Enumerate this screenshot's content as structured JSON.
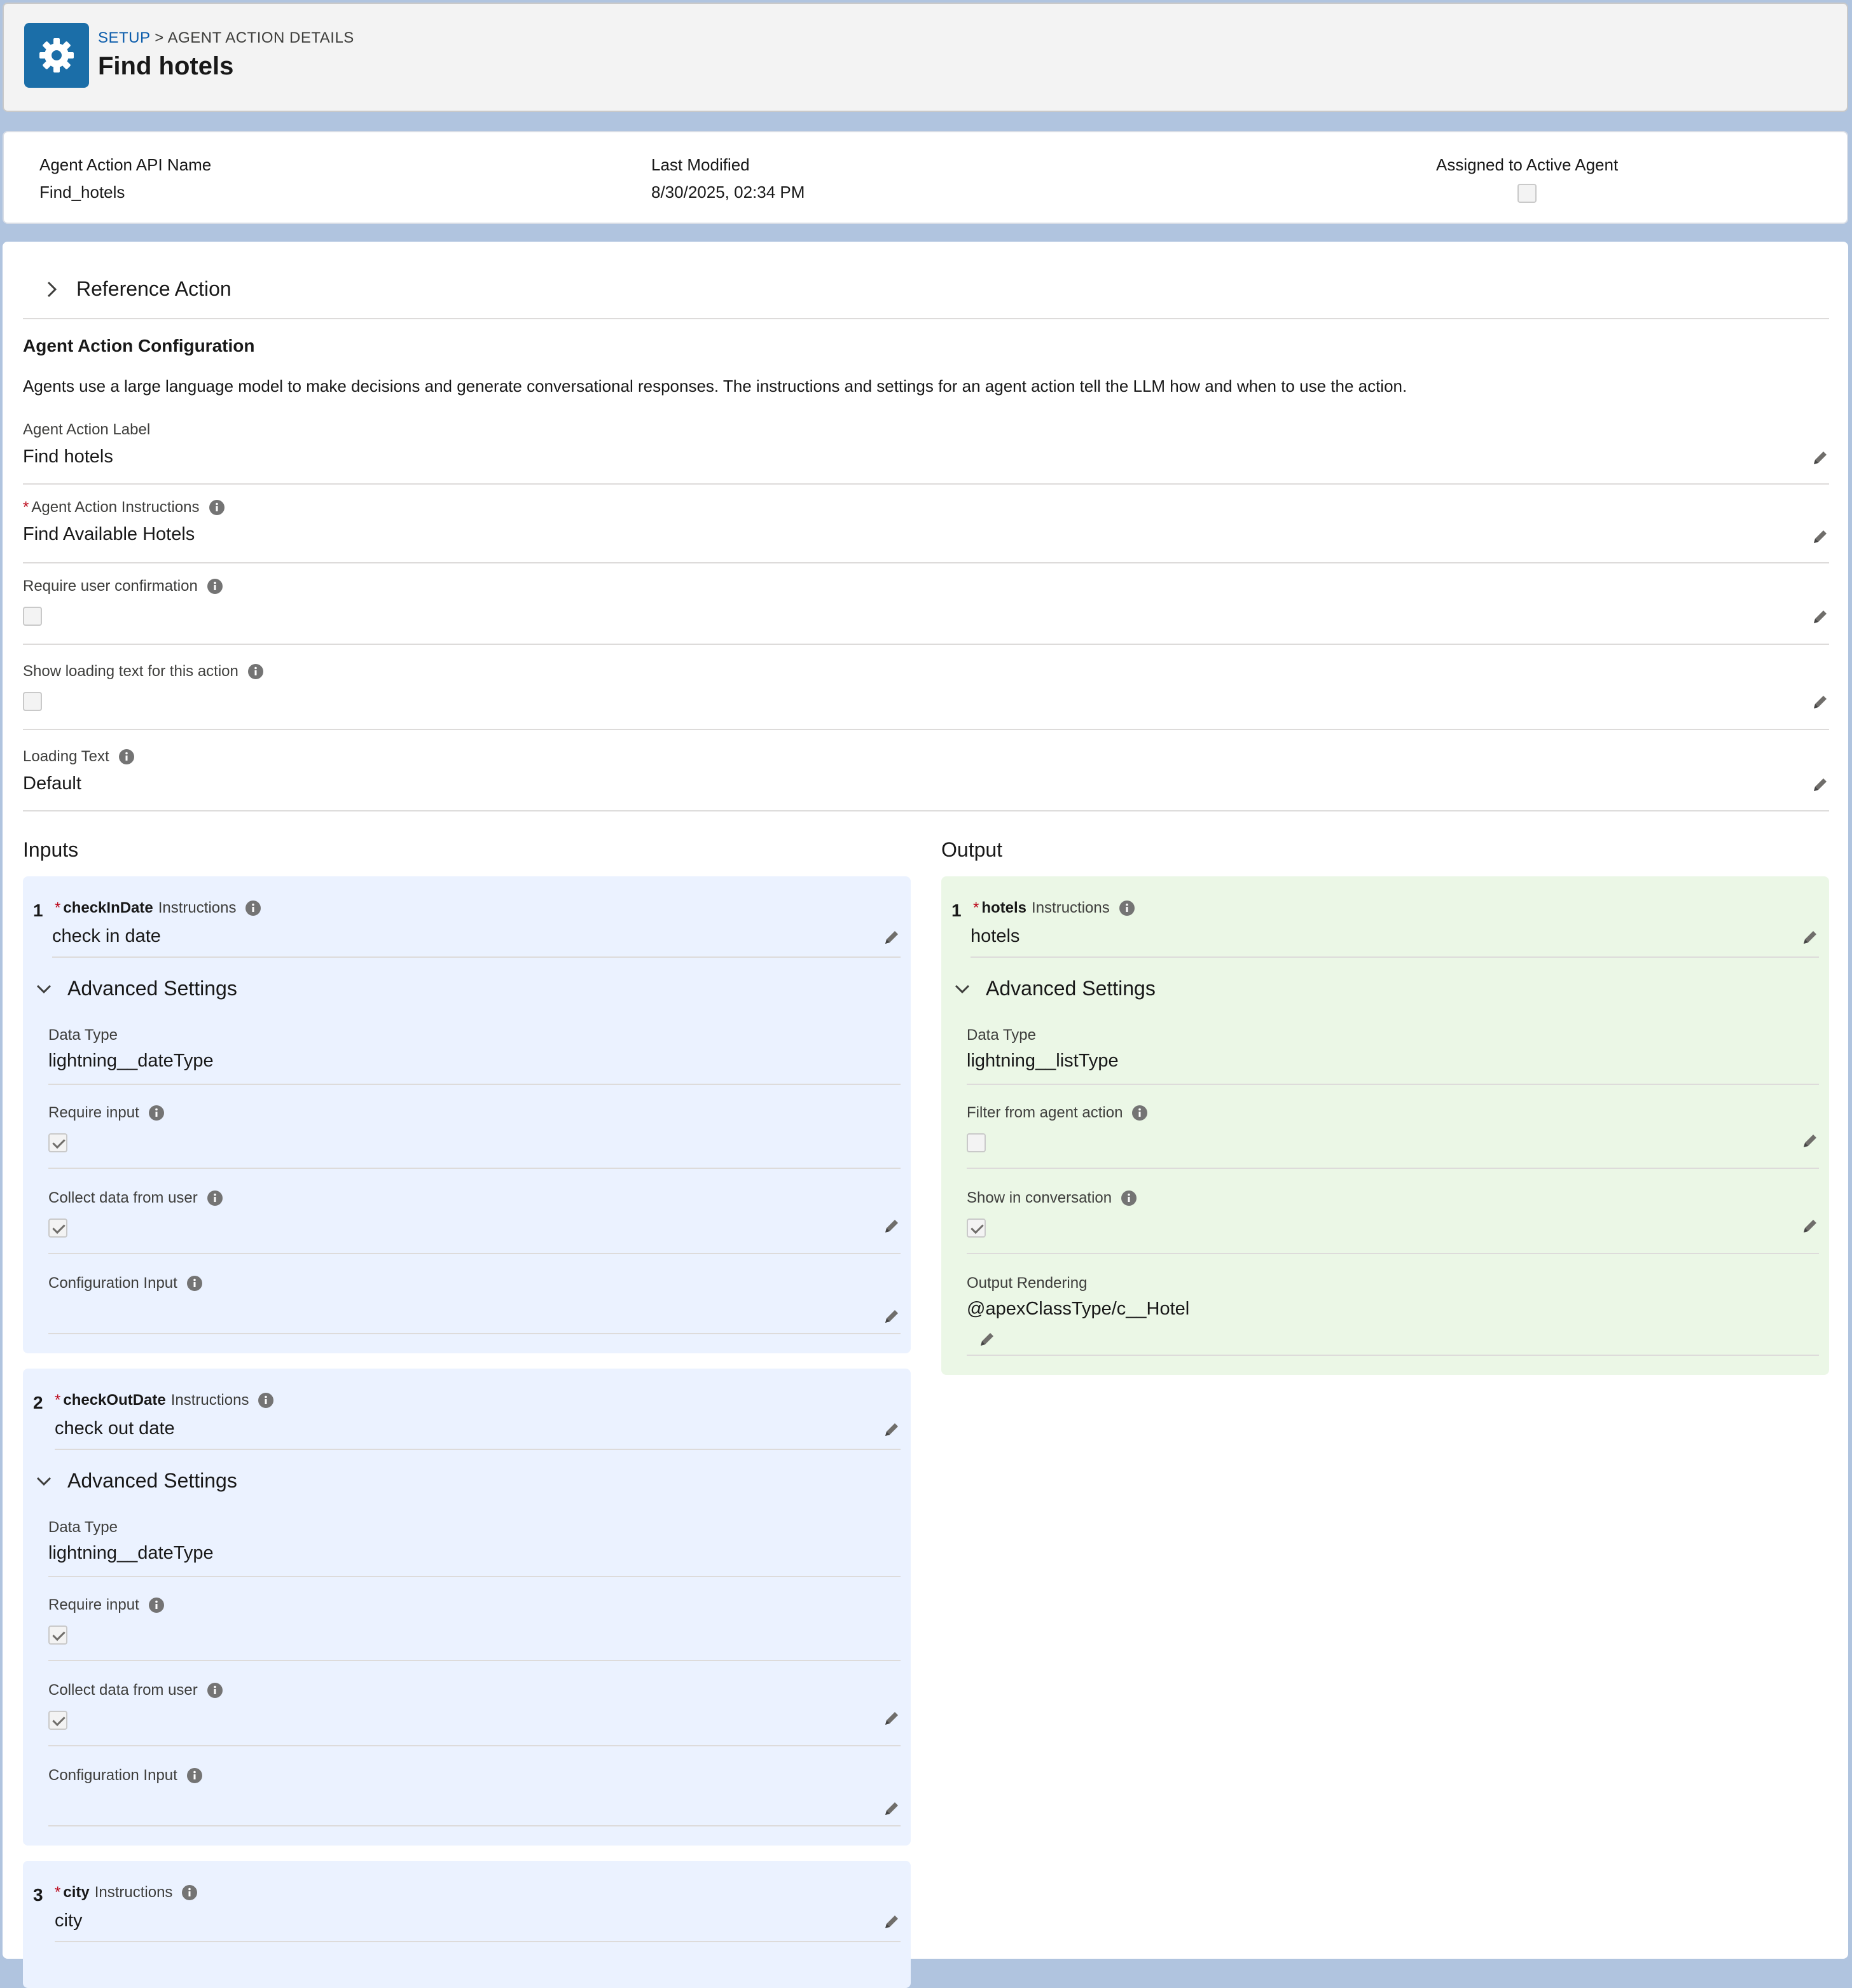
{
  "header": {
    "breadcrumb_root": "SETUP",
    "breadcrumb_sep": ">",
    "breadcrumb_current": "AGENT ACTION DETAILS",
    "title": "Find hotels",
    "icon": "gear-icon"
  },
  "highlights": {
    "api_name_label": "Agent Action API Name",
    "api_name_value": "Find_hotels",
    "modified_label": "Last Modified",
    "modified_value": "8/30/2025, 02:34 PM",
    "assigned_label": "Assigned to Active Agent",
    "assigned_checked": false
  },
  "reference_action": "Reference Action",
  "config": {
    "heading": "Agent Action Configuration",
    "description": "Agents use a large language model to make decisions and generate conversational responses. The instructions and settings for an agent action tell the LLM how and when to use the action.",
    "label_label": "Agent Action Label",
    "label_value": "Find hotels",
    "instructions_label": "Agent Action Instructions",
    "instructions_value": "Find Available Hotels",
    "confirm_label": "Require user confirmation",
    "loading_show_label": "Show loading text for this action",
    "loading_text_label": "Loading Text",
    "loading_text_value": "Default"
  },
  "inputs": {
    "title": "Inputs",
    "items": [
      {
        "num": "1",
        "name": "checkInDate",
        "instr_label": "Instructions",
        "value": "check in date",
        "adv": "Advanced Settings",
        "dt_label": "Data Type",
        "dt_value": "lightning__dateType",
        "req_label": "Require input",
        "collect_label": "Collect data from user",
        "cfg_label": "Configuration Input"
      },
      {
        "num": "2",
        "name": "checkOutDate",
        "instr_label": "Instructions",
        "value": "check out date",
        "adv": "Advanced Settings",
        "dt_label": "Data Type",
        "dt_value": "lightning__dateType",
        "req_label": "Require input",
        "collect_label": "Collect data from user",
        "cfg_label": "Configuration Input"
      },
      {
        "num": "3",
        "name": "city",
        "instr_label": "Instructions",
        "value": "city"
      }
    ]
  },
  "output": {
    "title": "Output",
    "num": "1",
    "name": "hotels",
    "instr_label": "Instructions",
    "value": "hotels",
    "adv": "Advanced Settings",
    "dt_label": "Data Type",
    "dt_value": "lightning__listType",
    "filter_label": "Filter from agent action",
    "show_label": "Show in conversation",
    "render_label": "Output Rendering",
    "render_value": "@apexClassType/c__Hotel"
  },
  "colors": {
    "brand_icon": "#1b6ea8",
    "input_panel": "#ebf2ff",
    "output_panel": "#ebf7e6",
    "link": "#0b5cab"
  }
}
